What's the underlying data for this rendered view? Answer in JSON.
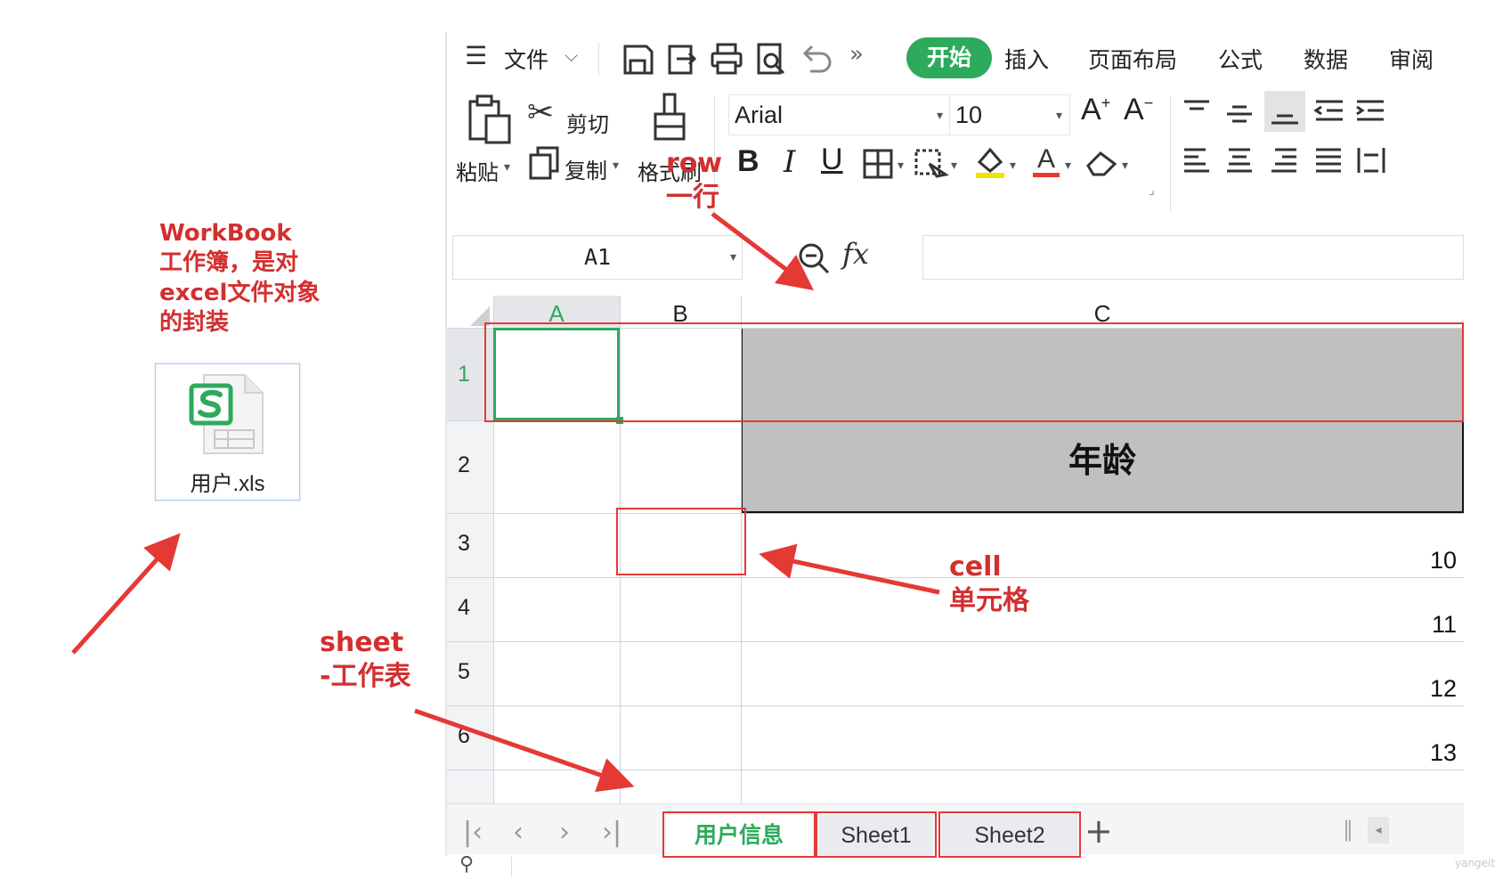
{
  "annotations": {
    "workbook": "WorkBook\n工作簿，是对\nexcel文件对象\n的封装",
    "row": "row\n一行",
    "cell": "cell\n单元格",
    "sheet": "sheet\n-工作表"
  },
  "file": {
    "name": "用户.xls",
    "icon": "spreadsheet-file-icon"
  },
  "menu": {
    "file_label": "文件",
    "tabs": [
      "开始",
      "插入",
      "页面布局",
      "公式",
      "数据",
      "审阅"
    ],
    "active_tab": "开始"
  },
  "ribbon": {
    "paste": "粘贴",
    "cut": "剪切",
    "copy": "复制",
    "format_painter": "格式刷",
    "font_name": "Arial",
    "font_size": "10"
  },
  "formula_bar": {
    "name_box": "A1",
    "fx": "fx",
    "value": ""
  },
  "grid": {
    "columns": [
      "A",
      "B",
      "C"
    ],
    "rows": [
      "1",
      "2",
      "3",
      "4",
      "5",
      "6"
    ],
    "header_c2": "年龄",
    "c_values": [
      "10",
      "11",
      "12",
      "13"
    ]
  },
  "sheets": {
    "tabs": [
      "用户信息",
      "Sheet1",
      "Sheet2"
    ],
    "active": "用户信息",
    "add": "+"
  },
  "watermark": "yangeit",
  "colors": {
    "accent_green": "#2eaa5d",
    "annotation_red": "#e53935",
    "header_gray": "#c0c0c0"
  }
}
